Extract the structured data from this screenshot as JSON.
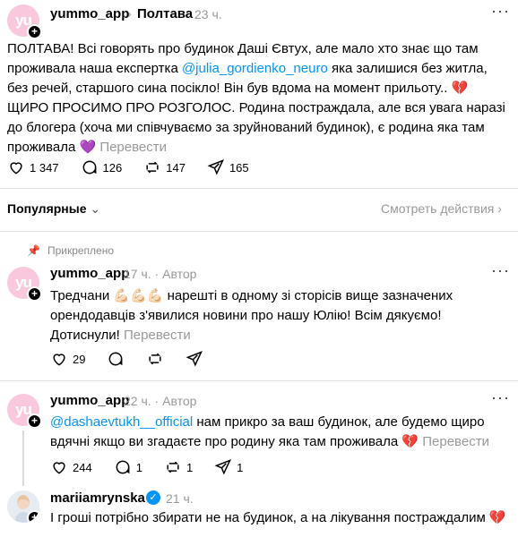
{
  "post": {
    "username": "yummo_app",
    "breadcrumb": "Полтава",
    "time": "23 ч.",
    "text_a": "ПОЛТАВА! Всі говорять про будинок Даші Євтух, але мало хто знає що там проживала наша експертка ",
    "mention": "@julia_gordienko_neuro",
    "text_b": " яка залишися без житла, без речей, старшого сина посікло! Він був вдома на момент прильоту.. 💔 ЩИРО ПРОСИМО ПРО РОЗГОЛОС. Родина постраждала, але вся увага наразі до блогера (хоча ми співчуваємо за зруйнований будинок), є родина яка там проживала 💜",
    "translate": "Перевести",
    "likes": "1 347",
    "replies": "126",
    "reposts": "147",
    "shares": "165"
  },
  "sort": {
    "label": "Популярные",
    "view_all": "Смотреть действия"
  },
  "comments": [
    {
      "pinned_label": "Прикреплено",
      "username": "yummo_app",
      "time": "17 ч.",
      "author": "Автор",
      "text": "Тредчани 💪🏻💪🏻💪🏻 нарешті в одному зі сторісів вище зазначених орендодавців з'явилися новини про нашу Юлію! Всім дякуємо! Дотиснули!",
      "translate": "Перевести",
      "likes": "29"
    },
    {
      "username": "yummo_app",
      "time": "22 ч.",
      "author": "Автор",
      "mention": "@dashaevtukh__official",
      "text": " нам прикро за ваш будинок, але будемо щиро вдячні якщо ви згадаєте про родину яка там проживала 💔",
      "translate": "Перевести",
      "likes": "244",
      "replies": "1",
      "reposts": "1",
      "shares": "1"
    },
    {
      "username": "mariiamrynska",
      "time": "21 ч.",
      "text": "І гроші потрібно збирати не на будинок, а на лікування постраждалим 💔"
    }
  ],
  "icons": [
    "heart-icon",
    "comment-icon",
    "repost-icon",
    "share-icon",
    "pin-icon",
    "more-icon",
    "chevron-right-icon",
    "chevron-down-icon",
    "verified-icon"
  ]
}
